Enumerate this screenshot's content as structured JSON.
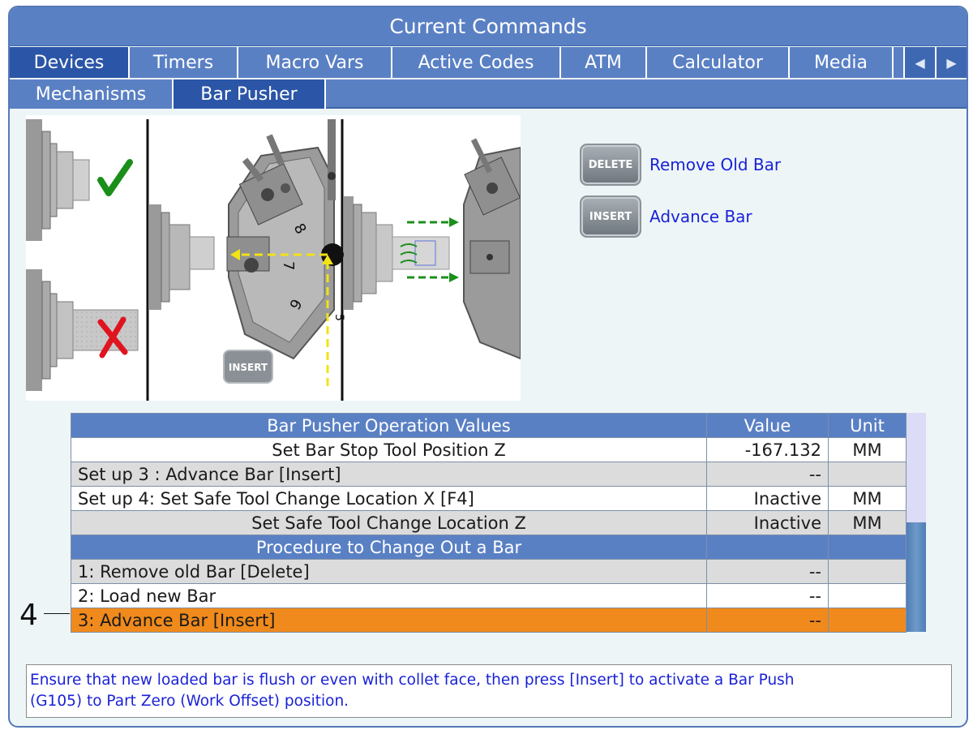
{
  "window": {
    "title": "Current Commands"
  },
  "tabs": [
    {
      "label": "Devices",
      "active": true
    },
    {
      "label": "Timers",
      "active": false
    },
    {
      "label": "Macro Vars",
      "active": false
    },
    {
      "label": "Active Codes",
      "active": false
    },
    {
      "label": "ATM",
      "active": false
    },
    {
      "label": "Calculator",
      "active": false
    },
    {
      "label": "Media",
      "active": false
    }
  ],
  "subtabs": [
    {
      "label": "Mechanisms",
      "active": false
    },
    {
      "label": "Bar Pusher",
      "active": true
    }
  ],
  "illustration": {
    "insert_key_label": "INSERT"
  },
  "keys": [
    {
      "key": "DELETE",
      "label": "Remove Old Bar"
    },
    {
      "key": "INSERT",
      "label": "Advance Bar"
    }
  ],
  "table": {
    "headers": {
      "name": "Bar Pusher Operation Values",
      "value": "Value",
      "unit": "Unit"
    },
    "rows": [
      {
        "name": "Set Bar Stop Tool Position Z",
        "value": "-167.132",
        "unit": "MM"
      },
      {
        "name": "Set up 3 : Advance Bar [Insert]",
        "value": "--",
        "unit": ""
      },
      {
        "name": "Set up 4: Set Safe Tool Change Location X [F4]",
        "value": "Inactive",
        "unit": "MM"
      },
      {
        "name": "Set Safe Tool Change Location Z",
        "value": "Inactive",
        "unit": "MM"
      },
      {
        "name": "Procedure to Change Out a Bar",
        "value": "",
        "unit": ""
      },
      {
        "name": "1: Remove old Bar [Delete]",
        "value": "--",
        "unit": ""
      },
      {
        "name": "2: Load new Bar",
        "value": "--",
        "unit": ""
      },
      {
        "name": "3: Advance Bar [Insert]",
        "value": "--",
        "unit": ""
      }
    ]
  },
  "callout": {
    "number": "4"
  },
  "message": {
    "line1": "Ensure that new loaded bar is flush or even with collet face, then press [Insert] to activate a Bar Push",
    "line2": "(G105) to Part Zero (Work Offset) position."
  },
  "colors": {
    "header_blue": "#5a80c4",
    "active_tab_blue": "#2b55a7",
    "highlight_orange": "#f08a1c",
    "message_text_blue": "#1a22d6"
  }
}
